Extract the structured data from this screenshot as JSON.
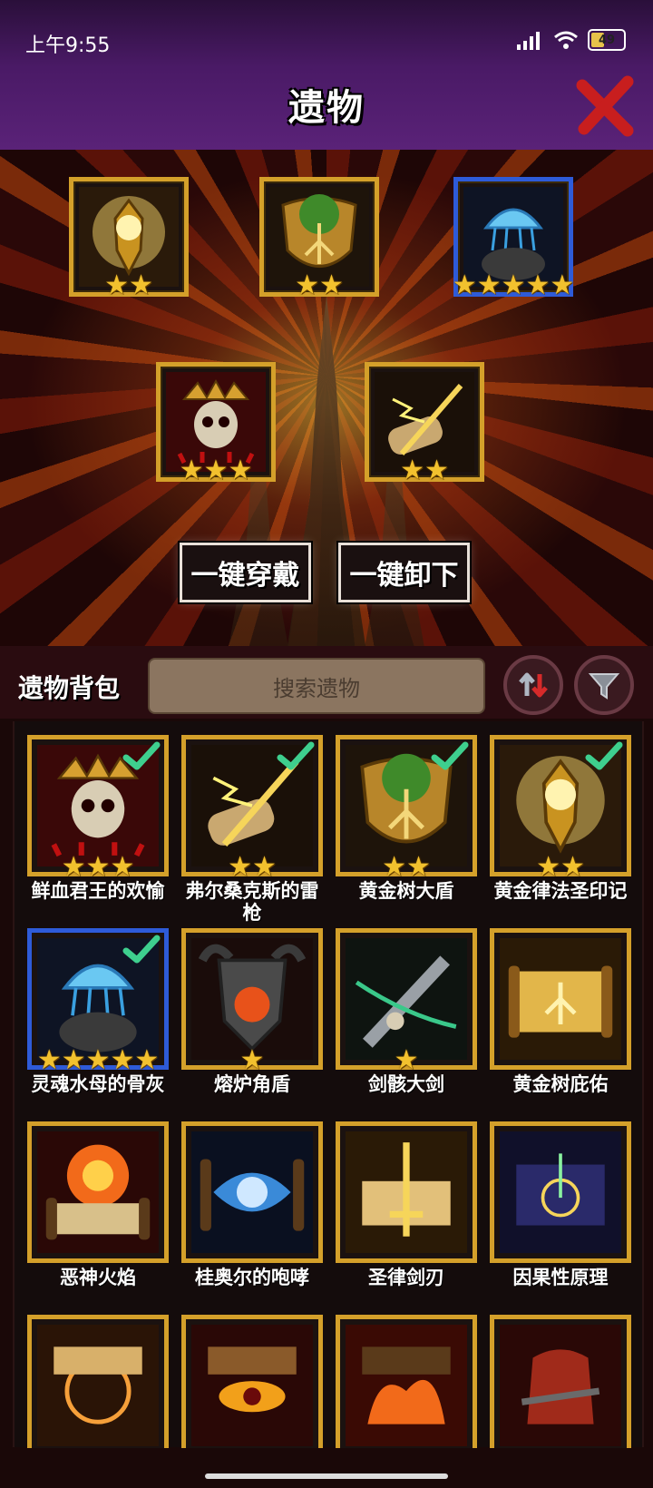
{
  "status_bar": {
    "time": "上午9:55",
    "battery": "49"
  },
  "header": {
    "title": "遗物"
  },
  "actions": {
    "equip_all": "一键穿戴",
    "unequip_all": "一键卸下"
  },
  "bag": {
    "title": "遗物背包",
    "search_placeholder": "搜索遗物"
  },
  "equipped": [
    {
      "icon": "golden-seal-icon",
      "stars": 2,
      "frame": "gold"
    },
    {
      "icon": "golden-tree-shield-icon",
      "stars": 2,
      "frame": "gold"
    },
    {
      "icon": "jellyfish-ash-icon",
      "stars": 5,
      "frame": "blue"
    },
    {
      "icon": "blood-king-skull-icon",
      "stars": 3,
      "frame": "gold"
    },
    {
      "icon": "thunder-spear-icon",
      "stars": 2,
      "frame": "gold"
    }
  ],
  "items": [
    {
      "name": "鲜血君王的欢愉",
      "icon": "blood-king-skull-icon",
      "stars": 3,
      "frame": "gold",
      "equipped": true
    },
    {
      "name": "弗尔桑克斯的雷枪",
      "icon": "thunder-spear-icon",
      "stars": 2,
      "frame": "gold",
      "equipped": true
    },
    {
      "name": "黄金树大盾",
      "icon": "golden-tree-shield-icon",
      "stars": 2,
      "frame": "gold",
      "equipped": true
    },
    {
      "name": "黄金律法圣印记",
      "icon": "golden-seal-icon",
      "stars": 2,
      "frame": "gold",
      "equipped": true
    },
    {
      "name": "灵魂水母的骨灰",
      "icon": "jellyfish-ash-icon",
      "stars": 5,
      "frame": "blue",
      "equipped": true
    },
    {
      "name": "熔炉角盾",
      "icon": "furnace-horn-shield-icon",
      "stars": 1,
      "frame": "gold",
      "equipped": false
    },
    {
      "name": "剑骸大剑",
      "icon": "skull-greatsword-icon",
      "stars": 1,
      "frame": "gold",
      "equipped": false
    },
    {
      "name": "黄金树庇佑",
      "icon": "golden-tree-scroll-icon",
      "stars": 0,
      "frame": "gold",
      "equipped": false
    },
    {
      "name": "恶神火焰",
      "icon": "fire-scroll-icon",
      "stars": 0,
      "frame": "gold",
      "equipped": false
    },
    {
      "name": "桂奥尔的咆哮",
      "icon": "dragon-scroll-icon",
      "stars": 0,
      "frame": "gold",
      "equipped": false
    },
    {
      "name": "圣律剑刃",
      "icon": "sword-scroll-icon",
      "stars": 0,
      "frame": "gold",
      "equipped": false
    },
    {
      "name": "因果性原理",
      "icon": "cosmic-scroll-icon",
      "stars": 0,
      "frame": "gold",
      "equipped": false
    },
    {
      "name": "",
      "icon": "rune-scroll-icon",
      "stars": 0,
      "frame": "gold",
      "equipped": false
    },
    {
      "name": "",
      "icon": "eye-scroll-icon",
      "stars": 0,
      "frame": "gold",
      "equipped": false
    },
    {
      "name": "",
      "icon": "flame-scroll-icon",
      "stars": 0,
      "frame": "gold",
      "equipped": false
    },
    {
      "name": "",
      "icon": "chained-sack-icon",
      "stars": 0,
      "frame": "gold",
      "equipped": false
    }
  ],
  "colors": {
    "gold_frame": "#d4a02a",
    "blue_frame": "#2e5bd8",
    "star": "#f2c12e",
    "check": "#3ecf8e",
    "header": "#4a1a66"
  }
}
